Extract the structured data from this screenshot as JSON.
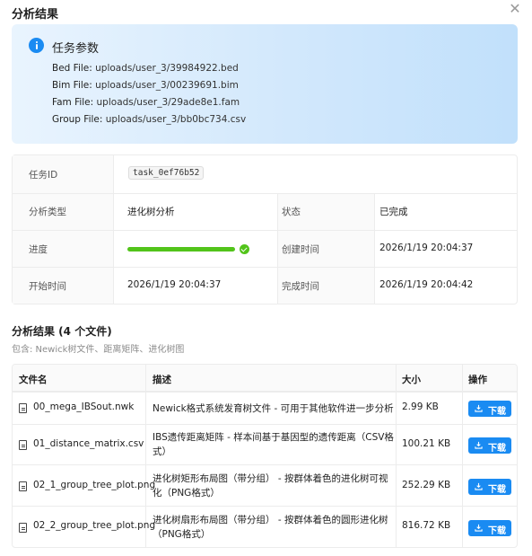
{
  "dialog": {
    "title": "分析结果",
    "close_icon": "close-icon"
  },
  "params": {
    "title": "任务参数",
    "icon": "info-icon",
    "lines": [
      {
        "label": "Bed File:",
        "value": "uploads/user_3/39984922.bed"
      },
      {
        "label": "Bim File:",
        "value": "uploads/user_3/00239691.bim"
      },
      {
        "label": "Fam File:",
        "value": "uploads/user_3/29ade8e1.fam"
      },
      {
        "label": "Group File:",
        "value": "uploads/user_3/bb0bc734.csv"
      }
    ]
  },
  "meta": {
    "task_id_label": "任务ID",
    "task_id": "task_0ef76b52",
    "type_label": "分析类型",
    "type": "进化树分析",
    "status_label": "状态",
    "status": "已完成",
    "progress_label": "进度",
    "progress": 1.0,
    "created_label": "创建时间",
    "created": "2026/1/19 20:04:37",
    "start_label": "开始时间",
    "start": "2026/1/19 20:04:37",
    "finish_label": "完成时间",
    "finish": "2026/1/19 20:04:42",
    "colors": {
      "success": "#52c41a",
      "accent": "#1a8bf2"
    }
  },
  "results": {
    "title": "分析结果 (4 个文件)",
    "subtitle": "包含: Newick树文件、距离矩阵、进化树图",
    "columns": [
      "文件名",
      "描述",
      "大小",
      "操作"
    ],
    "download_label": "下载",
    "rows": [
      {
        "name": "00_mega_IBSout.nwk",
        "desc": "Newick格式系统发育树文件 - 可用于其他软件进一步分析",
        "size": "2.99 KB"
      },
      {
        "name": "01_distance_matrix.csv",
        "desc": "IBS遗传距离矩阵 - 样本间基于基因型的遗传距离（CSV格式）",
        "size": "100.21 KB"
      },
      {
        "name": "02_1_group_tree_plot.png",
        "desc": "进化树矩形布局图（带分组） - 按群体着色的进化树可视化（PNG格式）",
        "size": "252.29 KB"
      },
      {
        "name": "02_2_group_tree_plot.png",
        "desc": "进化树扇形布局图（带分组） - 按群体着色的圆形进化树（PNG格式）",
        "size": "816.72 KB"
      }
    ]
  }
}
